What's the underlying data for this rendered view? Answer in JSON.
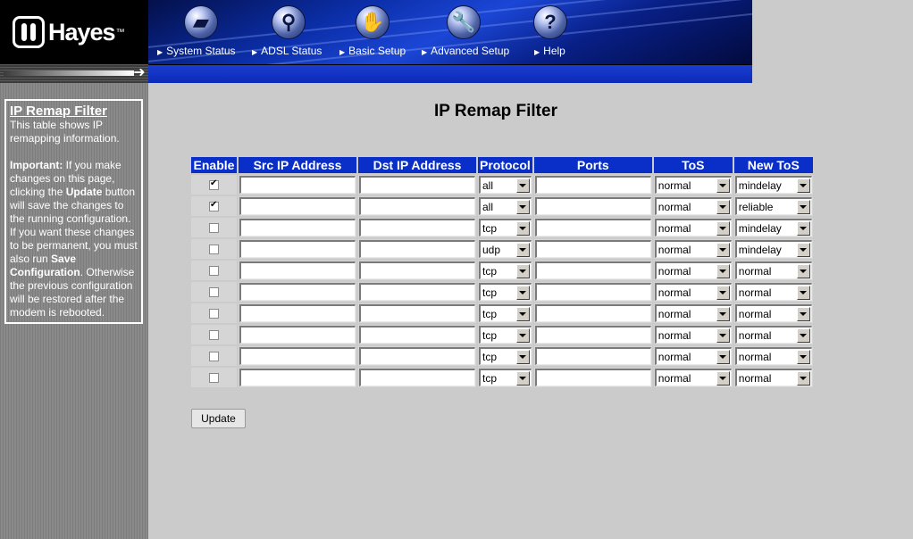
{
  "header": {
    "logo_text": "Hayes",
    "logo_tm": "™",
    "nav": [
      {
        "label": "System Status",
        "icon": "folder-icon"
      },
      {
        "label": "ADSL Status",
        "icon": "magnifier-icon"
      },
      {
        "label": "Basic Setup",
        "icon": "hand-icon"
      },
      {
        "label": "Advanced Setup",
        "icon": "wrench-icon"
      },
      {
        "label": "Help",
        "icon": "question-icon",
        "glyph": "?"
      }
    ]
  },
  "sidebar": {
    "title": "IP Remap Filter",
    "intro": "This table shows IP remapping information.",
    "important_label": "Important:",
    "text1": " If you make changes on this page, clicking the ",
    "update_word": "Update",
    "text2": " button will save the changes to the running configuration. If you want these changes to be permanent, you must also run ",
    "save_config": "Save Configuration",
    "text3": ". Otherwise the previous configuration will be restored after the modem is rebooted."
  },
  "main": {
    "title": "IP Remap Filter",
    "columns": [
      "Enable",
      "Src IP Address",
      "Dst IP Address",
      "Protocol",
      "Ports",
      "ToS",
      "New ToS"
    ],
    "rows": [
      {
        "enabled": true,
        "src": "",
        "dst": "",
        "protocol": "all",
        "ports": "",
        "tos": "normal",
        "new_tos": "mindelay"
      },
      {
        "enabled": true,
        "src": "",
        "dst": "",
        "protocol": "all",
        "ports": "",
        "tos": "normal",
        "new_tos": "reliable"
      },
      {
        "enabled": false,
        "src": "",
        "dst": "",
        "protocol": "tcp",
        "ports": "",
        "tos": "normal",
        "new_tos": "mindelay"
      },
      {
        "enabled": false,
        "src": "",
        "dst": "",
        "protocol": "udp",
        "ports": "",
        "tos": "normal",
        "new_tos": "mindelay"
      },
      {
        "enabled": false,
        "src": "",
        "dst": "",
        "protocol": "tcp",
        "ports": "",
        "tos": "normal",
        "new_tos": "normal"
      },
      {
        "enabled": false,
        "src": "",
        "dst": "",
        "protocol": "tcp",
        "ports": "",
        "tos": "normal",
        "new_tos": "normal"
      },
      {
        "enabled": false,
        "src": "",
        "dst": "",
        "protocol": "tcp",
        "ports": "",
        "tos": "normal",
        "new_tos": "normal"
      },
      {
        "enabled": false,
        "src": "",
        "dst": "",
        "protocol": "tcp",
        "ports": "",
        "tos": "normal",
        "new_tos": "normal"
      },
      {
        "enabled": false,
        "src": "",
        "dst": "",
        "protocol": "tcp",
        "ports": "",
        "tos": "normal",
        "new_tos": "normal"
      },
      {
        "enabled": false,
        "src": "",
        "dst": "",
        "protocol": "tcp",
        "ports": "",
        "tos": "normal",
        "new_tos": "normal"
      }
    ],
    "update_label": "Update"
  },
  "colors": {
    "header_blue": "#0a2fc8",
    "background": "#cbcbcb",
    "sidebar_gray": "#848484"
  }
}
